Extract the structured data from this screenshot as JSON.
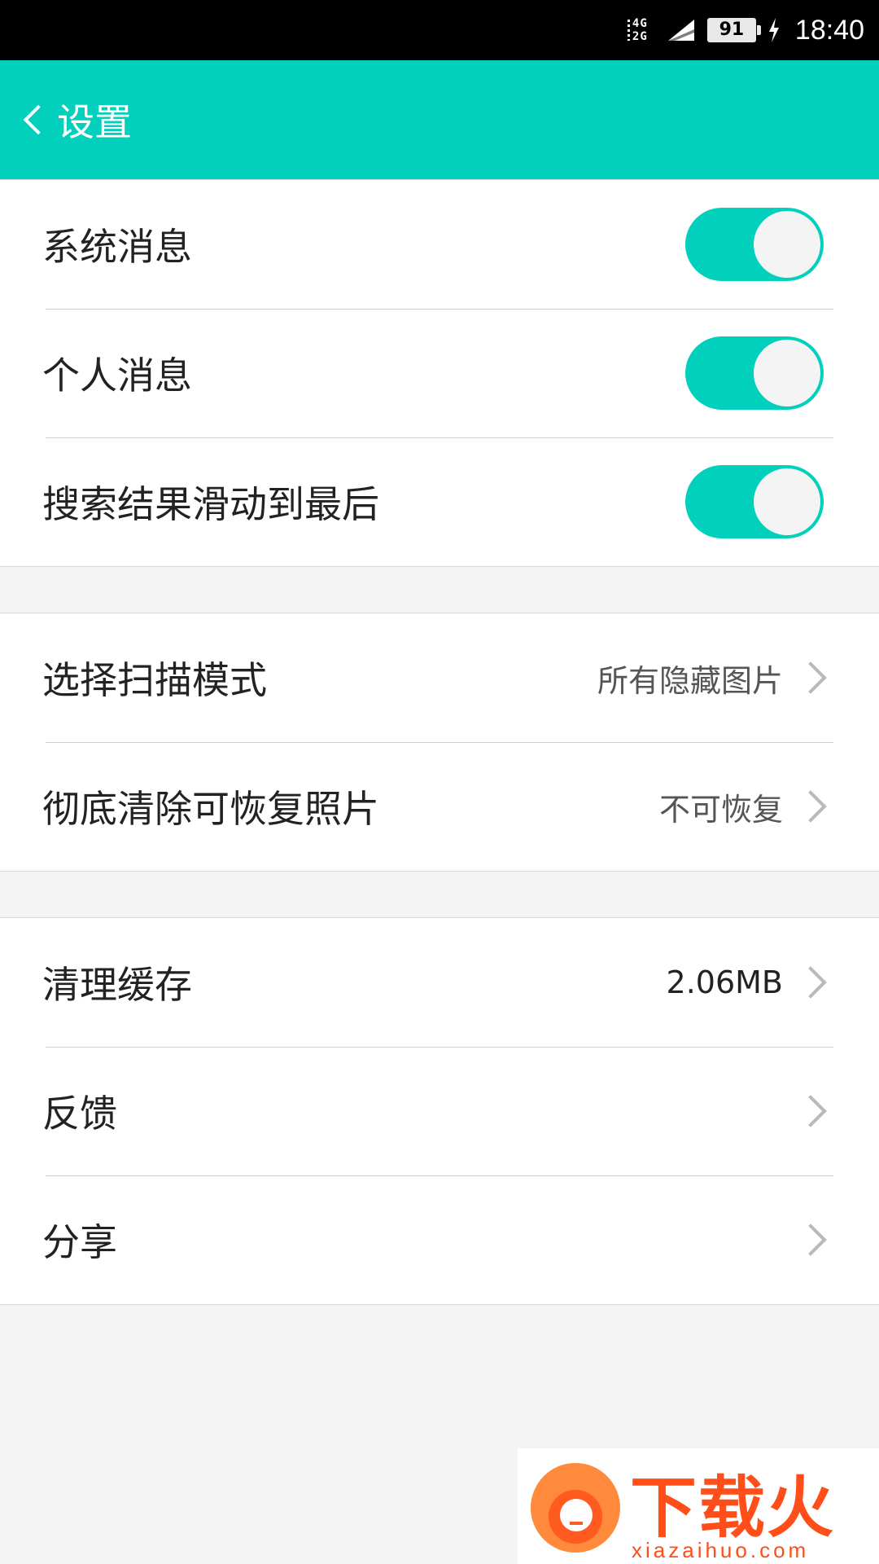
{
  "status_bar": {
    "network_top": "4G",
    "network_bottom": "2G",
    "battery_level": "91",
    "time": "18:40"
  },
  "header": {
    "title": "设置"
  },
  "section_notifications": {
    "items": [
      {
        "label": "系统消息",
        "on": true
      },
      {
        "label": "个人消息",
        "on": true
      },
      {
        "label": "搜索结果滑动到最后",
        "on": true
      }
    ]
  },
  "section_scan": {
    "items": [
      {
        "label": "选择扫描模式",
        "value": "所有隐藏图片"
      },
      {
        "label": "彻底清除可恢复照片",
        "value": "不可恢复"
      }
    ]
  },
  "section_misc": {
    "items": [
      {
        "label": "清理缓存",
        "value": "2.06MB"
      },
      {
        "label": "反馈",
        "value": ""
      },
      {
        "label": "分享",
        "value": ""
      }
    ]
  },
  "watermark": {
    "title": "下载火",
    "domain": "xiazaihuo.com"
  },
  "colors": {
    "accent": "#00d0bc",
    "status_bar": "#000000",
    "background": "#f4f4f4",
    "watermark": "#ff4e1a"
  }
}
